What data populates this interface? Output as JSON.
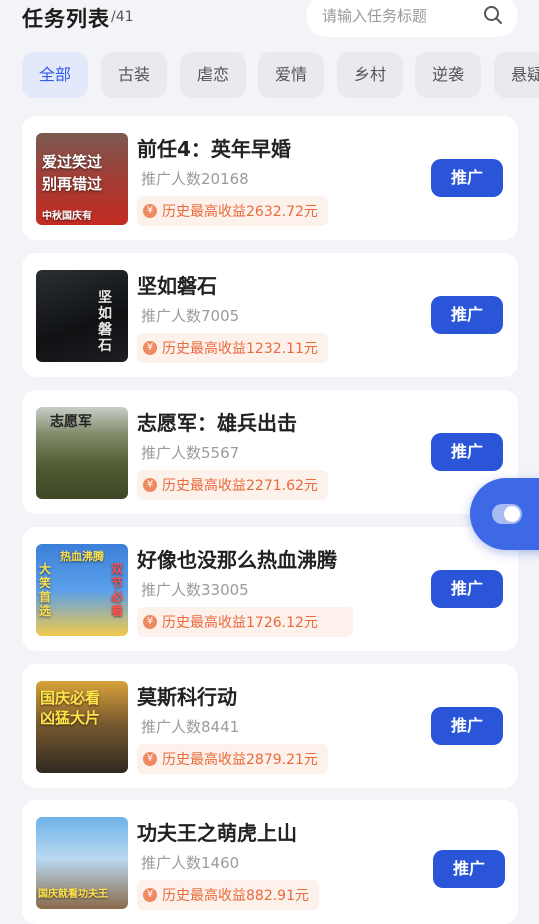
{
  "header": {
    "title": "任务列表",
    "count": "/41"
  },
  "search": {
    "placeholder": "请输入任务标题",
    "icon": "search-icon"
  },
  "tabs": [
    {
      "label": "全部",
      "active": true
    },
    {
      "label": "古装"
    },
    {
      "label": "虐恋"
    },
    {
      "label": "爱情"
    },
    {
      "label": "乡村"
    },
    {
      "label": "逆袭"
    },
    {
      "label": "悬疑"
    }
  ],
  "tasks": [
    {
      "title": "前任4：英年早婚",
      "promoters": "推广人数20168",
      "earnings": "历史最高收益2632.72元",
      "button": "推广",
      "poster_lines": [
        "爱过笑过",
        "别再错过",
        "中秋国庆有"
      ]
    },
    {
      "title": "坚如磐石",
      "promoters": "推广人数7005",
      "earnings": "历史最高收益1232.11元",
      "button": "推广",
      "poster_lines": [
        "坚如磐石"
      ]
    },
    {
      "title": "志愿军：雄兵出击",
      "promoters": "推广人数5567",
      "earnings": "历史最高收益2271.62元",
      "button": "推广",
      "poster_lines": [
        "志愿军"
      ]
    },
    {
      "title": "好像也没那么热血沸腾",
      "promoters": "推广人数33005",
      "earnings": "历史最高收益1726.12元",
      "button": "推广",
      "poster_lines": [
        "热血沸腾",
        "大笑首选",
        "双节必看"
      ]
    },
    {
      "title": "莫斯科行动",
      "promoters": "推广人数8441",
      "earnings": "历史最高收益2879.21元",
      "button": "推广",
      "poster_lines": [
        "国庆必看",
        "凶猛大片"
      ]
    },
    {
      "title": "功夫王之萌虎上山",
      "promoters": "推广人数1460",
      "earnings": "历史最高收益882.91元",
      "button": "推广",
      "poster_lines": [
        "国庆就看功夫王"
      ]
    }
  ],
  "colors": {
    "accent": "#2a55d8",
    "earnings": "#e96a3a",
    "background": "#f3f4f7"
  }
}
